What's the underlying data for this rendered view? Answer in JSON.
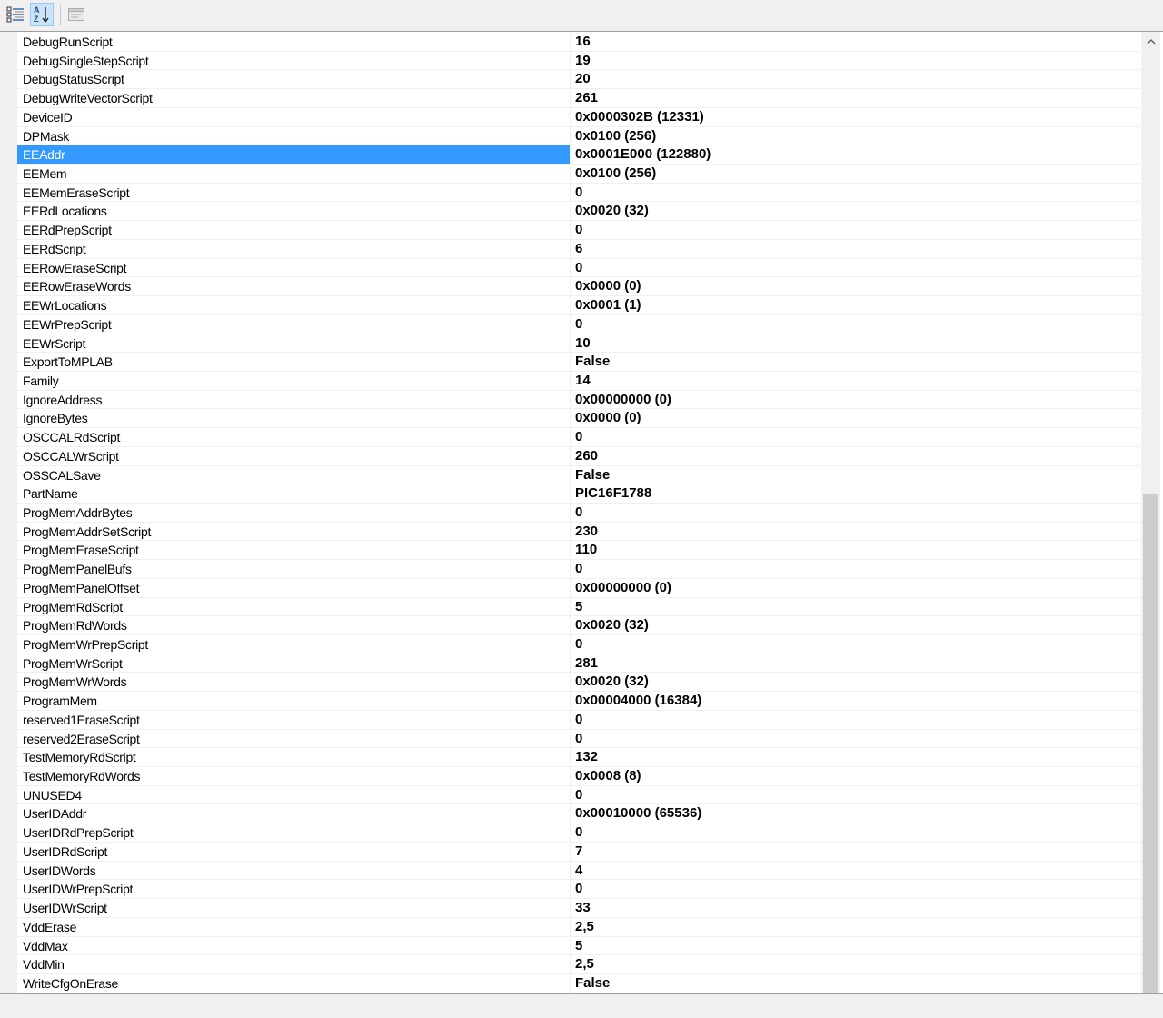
{
  "toolbar": {
    "categorized_icon": "categorized-view-icon",
    "alphabetical_icon": "alphabetical-sort-icon",
    "property_pages_icon": "property-pages-icon"
  },
  "colors": {
    "selection": "#3399ff",
    "grid_lines": "#f0f0f0"
  },
  "selected_property": "EEAddr",
  "properties": [
    {
      "name": "DebugRunScript",
      "value": "16"
    },
    {
      "name": "DebugSingleStepScript",
      "value": "19"
    },
    {
      "name": "DebugStatusScript",
      "value": "20"
    },
    {
      "name": "DebugWriteVectorScript",
      "value": "261"
    },
    {
      "name": "DeviceID",
      "value": "0x0000302B (12331)"
    },
    {
      "name": "DPMask",
      "value": "0x0100 (256)"
    },
    {
      "name": "EEAddr",
      "value": "0x0001E000 (122880)"
    },
    {
      "name": "EEMem",
      "value": "0x0100 (256)"
    },
    {
      "name": "EEMemEraseScript",
      "value": "0"
    },
    {
      "name": "EERdLocations",
      "value": "0x0020 (32)"
    },
    {
      "name": "EERdPrepScript",
      "value": "0"
    },
    {
      "name": "EERdScript",
      "value": "6"
    },
    {
      "name": "EERowEraseScript",
      "value": "0"
    },
    {
      "name": "EERowEraseWords",
      "value": "0x0000 (0)"
    },
    {
      "name": "EEWrLocations",
      "value": "0x0001 (1)"
    },
    {
      "name": "EEWrPrepScript",
      "value": "0"
    },
    {
      "name": "EEWrScript",
      "value": "10"
    },
    {
      "name": "ExportToMPLAB",
      "value": "False"
    },
    {
      "name": "Family",
      "value": "14"
    },
    {
      "name": "IgnoreAddress",
      "value": "0x00000000 (0)"
    },
    {
      "name": "IgnoreBytes",
      "value": "0x0000 (0)"
    },
    {
      "name": "OSCCALRdScript",
      "value": "0"
    },
    {
      "name": "OSCCALWrScript",
      "value": "260"
    },
    {
      "name": "OSSCALSave",
      "value": "False"
    },
    {
      "name": "PartName",
      "value": "PIC16F1788"
    },
    {
      "name": "ProgMemAddrBytes",
      "value": "0"
    },
    {
      "name": "ProgMemAddrSetScript",
      "value": "230"
    },
    {
      "name": "ProgMemEraseScript",
      "value": "110"
    },
    {
      "name": "ProgMemPanelBufs",
      "value": "0"
    },
    {
      "name": "ProgMemPanelOffset",
      "value": "0x00000000 (0)"
    },
    {
      "name": "ProgMemRdScript",
      "value": "5"
    },
    {
      "name": "ProgMemRdWords",
      "value": "0x0020 (32)"
    },
    {
      "name": "ProgMemWrPrepScript",
      "value": "0"
    },
    {
      "name": "ProgMemWrScript",
      "value": "281"
    },
    {
      "name": "ProgMemWrWords",
      "value": "0x0020 (32)"
    },
    {
      "name": "ProgramMem",
      "value": "0x00004000 (16384)"
    },
    {
      "name": "reserved1EraseScript",
      "value": "0"
    },
    {
      "name": "reserved2EraseScript",
      "value": "0"
    },
    {
      "name": "TestMemoryRdScript",
      "value": "132"
    },
    {
      "name": "TestMemoryRdWords",
      "value": "0x0008 (8)"
    },
    {
      "name": "UNUSED4",
      "value": "0"
    },
    {
      "name": "UserIDAddr",
      "value": "0x00010000 (65536)"
    },
    {
      "name": "UserIDRdPrepScript",
      "value": "0"
    },
    {
      "name": "UserIDRdScript",
      "value": "7"
    },
    {
      "name": "UserIDWords",
      "value": "4"
    },
    {
      "name": "UserIDWrPrepScript",
      "value": "0"
    },
    {
      "name": "UserIDWrScript",
      "value": "33"
    },
    {
      "name": "VddErase",
      "value": "2,5"
    },
    {
      "name": "VddMax",
      "value": "5"
    },
    {
      "name": "VddMin",
      "value": "2,5"
    },
    {
      "name": "WriteCfgOnErase",
      "value": "False"
    }
  ]
}
